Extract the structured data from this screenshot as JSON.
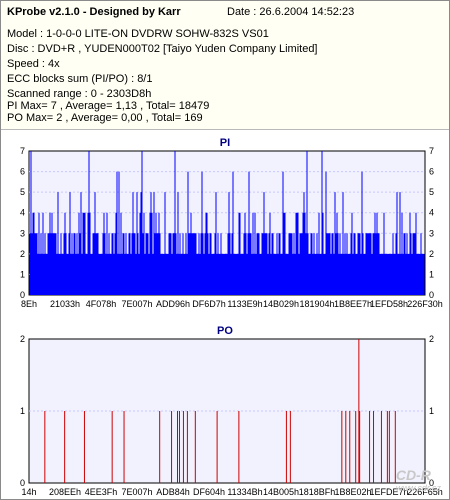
{
  "header": {
    "title": "KProbe v2.1.0 - Designed by Karr",
    "date": "Date : 26.6.2004 14:52:23"
  },
  "info": {
    "model": "Model : 1-0-0-0 LITE-ON DVDRW SOHW-832S  VS01",
    "disc": "Disc : DVD+R , YUDEN000T02 [Taiyo Yuden Company Limited]",
    "speed": "Speed : 4x",
    "ecc": "ECC blocks sum (PI/PO) : 8/1",
    "scanned": "Scanned range : 0 - 2303D8h",
    "pi_stats": "PI Max= 7 , Average= 1,13 , Total= 18479",
    "po_stats": "PO Max= 2 , Average= 0,00 , Total= 169"
  },
  "watermark": {
    "main": "CD-R",
    "sub": "www.cdr.cz"
  },
  "chart_data": [
    {
      "type": "bar",
      "title": "PI",
      "ylim": [
        0,
        7
      ],
      "y_ticks": [
        "0",
        "1",
        "2",
        "3",
        "4",
        "5",
        "6",
        "7"
      ],
      "x_tick_labels": [
        "8Eh",
        "21033h",
        "4F078h",
        "7E007h",
        "ADD96h",
        "DF6D7h",
        "1133E9h",
        "14B029h",
        "181904h",
        "1B8EE7h",
        "1EFD58h",
        "226F30h"
      ],
      "color": "#0000ff",
      "baseline_level": 2,
      "typical_band": [
        2,
        3
      ],
      "note_peaks_levels": [
        4,
        5,
        6,
        7
      ]
    },
    {
      "type": "bar",
      "title": "PO",
      "ylim": [
        0,
        2
      ],
      "y_ticks": [
        "0",
        "1",
        "2"
      ],
      "x_tick_labels": [
        "14h",
        "208EEh",
        "4EE3Fh",
        "7E007h",
        "ADB84h",
        "DF604h",
        "11334Bh",
        "14B005h",
        "1818BFh",
        "1B8E02h",
        "1EFDE7h",
        "226F65h"
      ],
      "color": "#cc0000",
      "spike_positions": [
        0.04,
        0.09,
        0.14,
        0.21,
        0.24,
        0.33,
        0.36,
        0.375,
        0.38,
        0.39,
        0.4,
        0.42,
        0.475,
        0.53,
        0.65,
        0.66,
        0.79,
        0.8,
        0.81,
        0.825,
        0.835,
        0.86,
        0.87,
        0.89,
        0.905,
        0.91,
        0.925
      ],
      "spike_value": 1,
      "max_spike_position": 0.833,
      "max_spike_value": 2
    }
  ]
}
